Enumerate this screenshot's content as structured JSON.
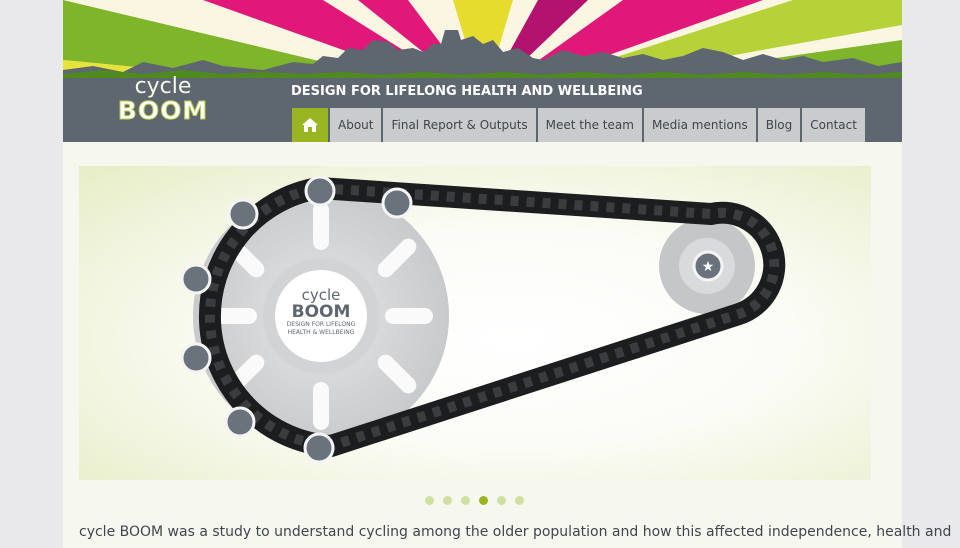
{
  "site": {
    "logo_line1": "cycle",
    "logo_line2": "BOOM",
    "tagline": "DESIGN FOR LIFELONG HEALTH AND WELLBEING"
  },
  "nav": {
    "home_icon": "home-icon",
    "items": [
      "About",
      "Final Report & Outputs",
      "Meet the team",
      "Media mentions",
      "Blog",
      "Contact"
    ],
    "active": "home"
  },
  "hero": {
    "center_logo_line1": "cycle",
    "center_logo_line2": "BOOM",
    "center_logo_line3": "DESIGN FOR LIFELONG",
    "center_logo_line4": "HEALTH & WELLBEING",
    "chain_icons": [
      "people-icon",
      "document-icon",
      "monitor-icon",
      "family-icon",
      "cube-icon",
      "checklist-icon",
      "location-pin-icon",
      "star-icon"
    ]
  },
  "slider": {
    "count": 6,
    "active_index": 3
  },
  "intro_text": "cycle BOOM was a study to understand cycling among the older population and how this affected independence, health and",
  "colors": {
    "accent_green": "#9ab522",
    "nav_bg": "#c9cbcd",
    "header_grey": "#5e6770",
    "ray_magenta": "#e0187a",
    "ray_yellow": "#ede53b"
  }
}
